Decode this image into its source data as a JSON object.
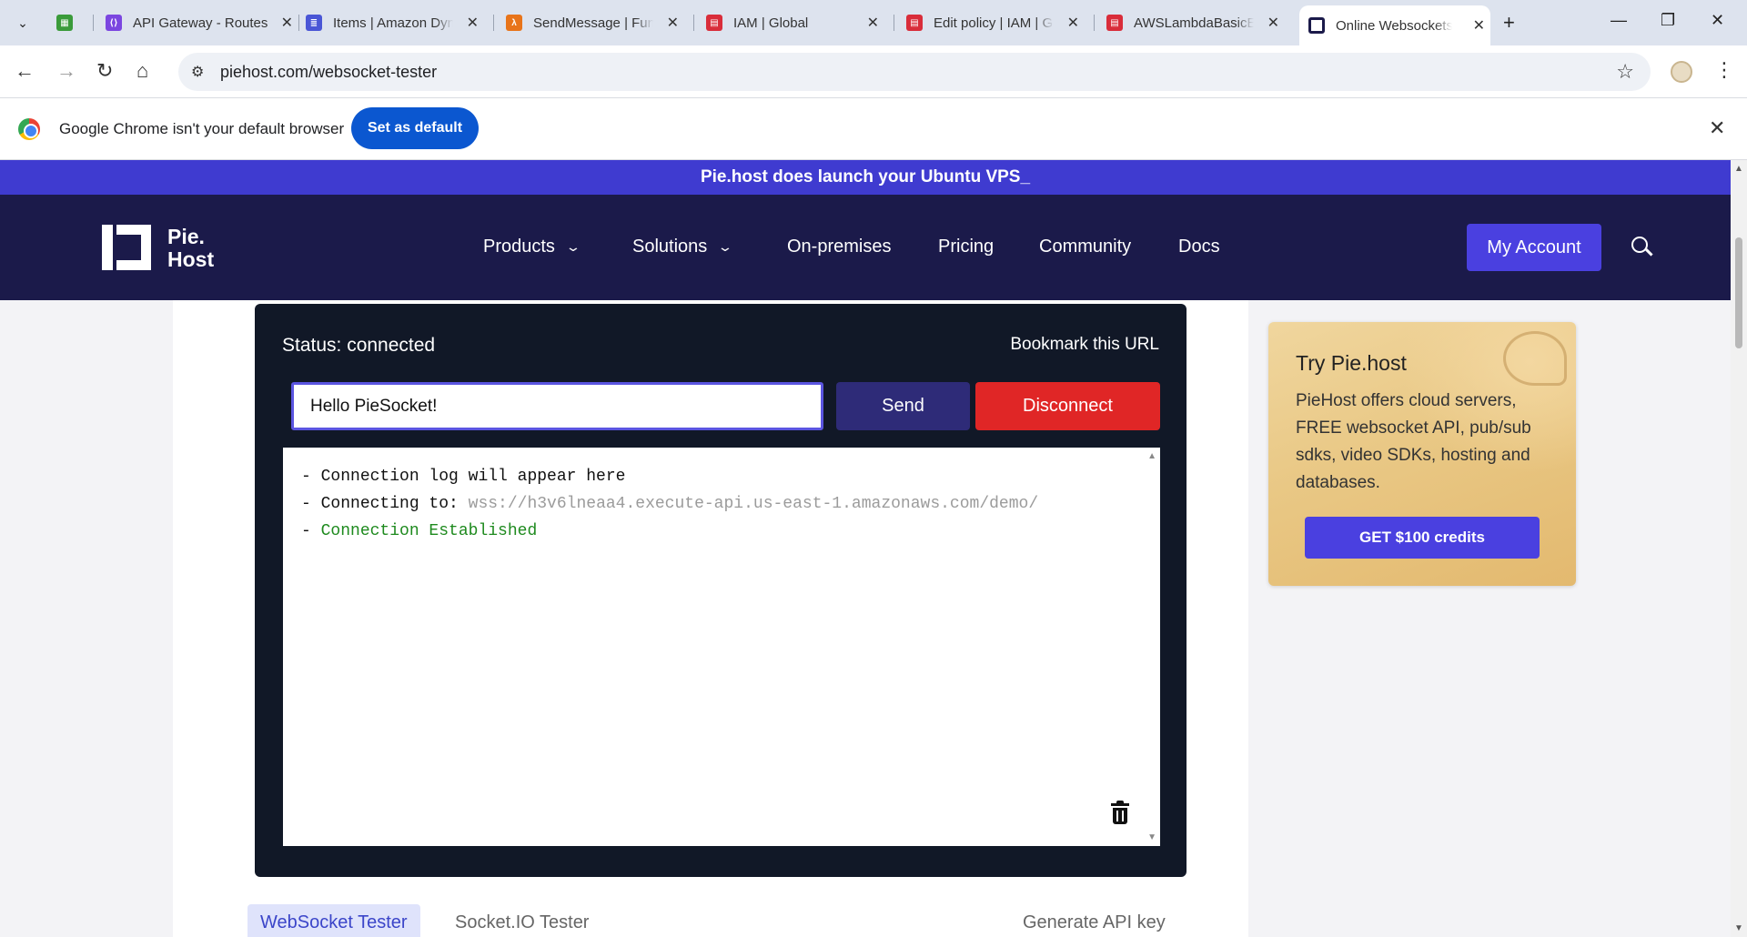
{
  "browser": {
    "tabs": [
      {
        "title": "",
        "favicon_color": "#3a9b3a"
      },
      {
        "title": "API Gateway - Routes",
        "favicon_color": "#7b46e0"
      },
      {
        "title": "Items | Amazon DynamoDB",
        "favicon_color": "#4a56d6"
      },
      {
        "title": "SendMessage | Functions",
        "favicon_color": "#e8741a"
      },
      {
        "title": "IAM | Global",
        "favicon_color": "#d92d3a"
      },
      {
        "title": "Edit policy | IAM | Global",
        "favicon_color": "#d92d3a"
      },
      {
        "title": "AWSLambdaBasicExecutionRole",
        "favicon_color": "#d92d3a"
      },
      {
        "title": "Online Websockets Tester",
        "favicon_color": "#1b1a4a",
        "active": true
      }
    ],
    "url": "piehost.com/websocket-tester",
    "infobar": {
      "message": "Google Chrome isn't your default browser",
      "button": "Set as default"
    }
  },
  "site": {
    "promo": "Pie.host does launch your Ubuntu VPS_",
    "logo": {
      "line1": "Pie.",
      "line2": "Host"
    },
    "nav": [
      {
        "label": "Products",
        "has_dropdown": true
      },
      {
        "label": "Solutions",
        "has_dropdown": true
      },
      {
        "label": "On-premises",
        "has_dropdown": false
      },
      {
        "label": "Pricing",
        "has_dropdown": false
      },
      {
        "label": "Community",
        "has_dropdown": false
      },
      {
        "label": "Docs",
        "has_dropdown": false
      }
    ],
    "account_button": "My Account"
  },
  "tester": {
    "status": "Status: connected",
    "bookmark": "Bookmark this URL",
    "message_value": "Hello PieSocket!",
    "send_label": "Send",
    "disconnect_label": "Disconnect",
    "log": [
      {
        "prefix": "- ",
        "text": "Connection log will appear here",
        "highlight": ""
      },
      {
        "prefix": "- ",
        "text": "Connecting to: ",
        "highlight": "wss://h3v6lneaa4.execute-api.us-east-1.amazonaws.com/demo/"
      },
      {
        "prefix": "- ",
        "text": "",
        "highlight": "Connection Established"
      }
    ],
    "tabs": {
      "websocket": "WebSocket Tester",
      "socketio": "Socket.IO Tester",
      "api_key": "Generate API key"
    }
  },
  "ad": {
    "title": "Try Pie.host",
    "text": "PieHost offers cloud servers, FREE websocket API, pub/sub sdks, video SDKs, hosting and databases.",
    "button": "GET $100 credits"
  },
  "colors": {
    "promo_bg": "#3f3bd0",
    "header_bg": "#1b1a4a",
    "accent": "#4a40e0",
    "disconnect": "#e02626",
    "send": "#2e2b78",
    "log_ok": "#1e8a1e"
  }
}
